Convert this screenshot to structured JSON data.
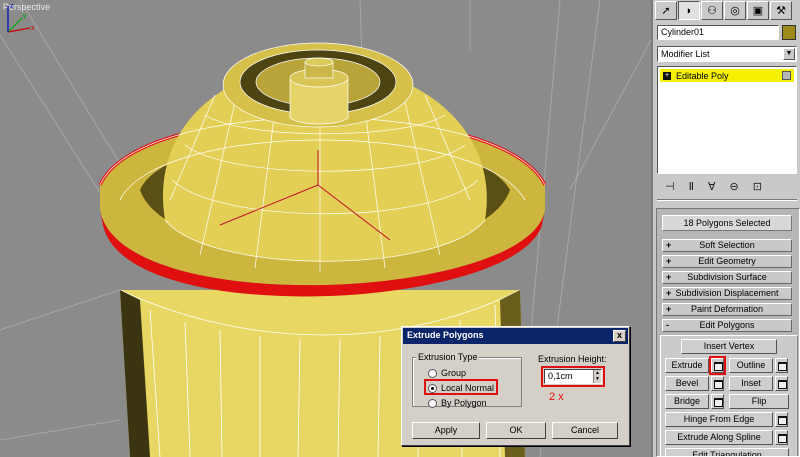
{
  "viewport": {
    "label": "Perspective"
  },
  "panel": {
    "tabs": [
      "create",
      "modify",
      "hierarchy",
      "motion",
      "display",
      "utilities"
    ],
    "object_name": "Cylinder01",
    "object_color": "#9d8a19",
    "modifier_list": "Modifier List",
    "stack_item": "Editable Poly",
    "selection_info": "18 Polygons Selected",
    "rollouts": [
      {
        "sign": "+",
        "label": "Soft Selection"
      },
      {
        "sign": "+",
        "label": "Edit Geometry"
      },
      {
        "sign": "+",
        "label": "Subdivision Surface"
      },
      {
        "sign": "+",
        "label": "Subdivision Displacement"
      },
      {
        "sign": "+",
        "label": "Paint Deformation"
      },
      {
        "sign": "-",
        "label": "Edit Polygons"
      }
    ],
    "edit_polygons": {
      "insert_vertex": "Insert Vertex",
      "extrude": "Extrude",
      "outline": "Outline",
      "bevel": "Bevel",
      "inset": "Inset",
      "bridge": "Bridge",
      "flip": "Flip",
      "hinge": "Hinge From Edge",
      "extrude_spline": "Extrude Along Spline",
      "edit_triangulation": "Edit Triangulation"
    }
  },
  "dialog": {
    "title": "Extrude Polygons",
    "close": "x",
    "type_group": "Extrusion Type",
    "options": [
      "Group",
      "Local Normal",
      "By Polygon"
    ],
    "selected": "Local Normal",
    "height_label": "Extrusion Height:",
    "height_value": "0,1cm",
    "annotation": "2 x",
    "apply": "Apply",
    "ok": "OK",
    "cancel": "Cancel"
  },
  "colors": {
    "highlight": "#e01010",
    "mesh": "#d9c24a",
    "selection": "#ff0000"
  }
}
